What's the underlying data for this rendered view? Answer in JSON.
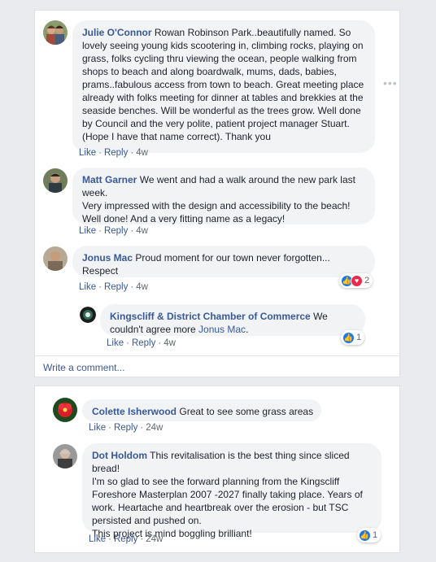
{
  "card1": {
    "comments": [
      {
        "author": "Julie O'Connor",
        "text": "Rowan Robinson Park..beautifully named. So lovely seeing young kids scootering in, climbing rocks, playing on grass, folks cycling thru viewing the ocean, people walking from shops to beach and along boardwalk, mums, dads, babies, prams..fabulous access from town to beach. Great meeting place already with folks meeting for dinner at tables and brekkies at the seaside benches. Will be wonderful as the trees grow. Well done by Council and the very polite, patient project manager Stuart. (Hope I have that name correct). Thank you",
        "like": "Like",
        "reply": "Reply",
        "time": "4w"
      },
      {
        "author": "Matt Garner",
        "text_lines": [
          "We went and had a walk around the new park last week.",
          "Very impressed with the design and accessibility to the beach! Well done! And a very fitting name as a legacy!"
        ],
        "like": "Like",
        "reply": "Reply",
        "time": "4w"
      },
      {
        "author": "Jonus Mac",
        "text": "Proud moment for our town never forgotten... Respect",
        "like": "Like",
        "reply": "Reply",
        "time": "4w",
        "reaction_count": "2"
      }
    ],
    "reply": {
      "author": "Kingscliff & District Chamber of Commerce",
      "text_before": "We couldn't agree more",
      "mention": "Jonus Mac",
      "text_after": ".",
      "like": "Like",
      "reply": "Reply",
      "time": "4w",
      "reaction_count": "1"
    },
    "write_comment": "Write a comment...",
    "more": "•••"
  },
  "card2": {
    "comments": [
      {
        "author": "Colette Isherwood",
        "text": "Great to see some grass areas",
        "like": "Like",
        "reply": "Reply",
        "time": "24w"
      },
      {
        "author": "Dot Holdom",
        "text_lines": [
          "This revitalisation is the best thing since sliced bread!",
          "I'm so glad to see the forward planning from the Kingscliff Foreshore Masterplan 2007 -2027 finally taking place. Years of work. Heartache and heartbreak over the erosion - but TSC persisted and pushed on.",
          "This project is mind boggling brilliant!"
        ],
        "like": "Like",
        "reply": "Reply",
        "time": "24w",
        "reaction_count": "1"
      }
    ]
  },
  "colors": {
    "link": "#385898",
    "bubble": "#f2f3f5",
    "background": "#e9ebee",
    "like_blue": "#1877f2",
    "love_red": "#f0284a"
  }
}
